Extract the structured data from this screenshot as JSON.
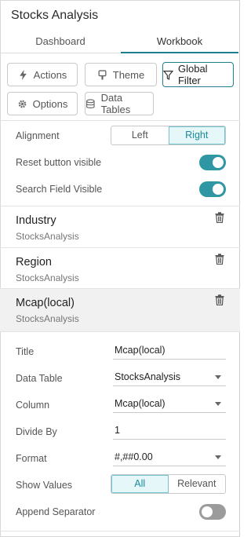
{
  "app": {
    "title": "Stocks Analysis"
  },
  "tabs": [
    {
      "label": "Dashboard"
    },
    {
      "label": "Workbook"
    }
  ],
  "toolbar": {
    "actions": "Actions",
    "theme": "Theme",
    "global_filter": "Global Filter",
    "options": "Options",
    "data_tables": "Data Tables"
  },
  "alignment": {
    "label": "Alignment",
    "options": [
      "Left",
      "Right"
    ],
    "selected": "Right"
  },
  "reset_button": {
    "label": "Reset button visible",
    "on": true
  },
  "search_field": {
    "label": "Search Field Visible",
    "on": true
  },
  "filters": [
    {
      "name": "Industry",
      "source": "StocksAnalysis"
    },
    {
      "name": "Region",
      "source": "StocksAnalysis"
    },
    {
      "name": "Mcap(local)",
      "source": "StocksAnalysis"
    }
  ],
  "details": {
    "title_label": "Title",
    "title_value": "Mcap(local)",
    "data_table_label": "Data Table",
    "data_table_value": "StocksAnalysis",
    "column_label": "Column",
    "column_value": "Mcap(local)",
    "divide_label": "Divide By",
    "divide_value": "1",
    "format_label": "Format",
    "format_value": "#,##0.00",
    "show_values_label": "Show Values",
    "show_values_options": [
      "All",
      "Relevant"
    ],
    "show_values_selected": "All",
    "append_label": "Append Separator",
    "append_on": false
  },
  "colors": {
    "accent": "#2f97a3",
    "selected_row": "#f1f1f1"
  }
}
